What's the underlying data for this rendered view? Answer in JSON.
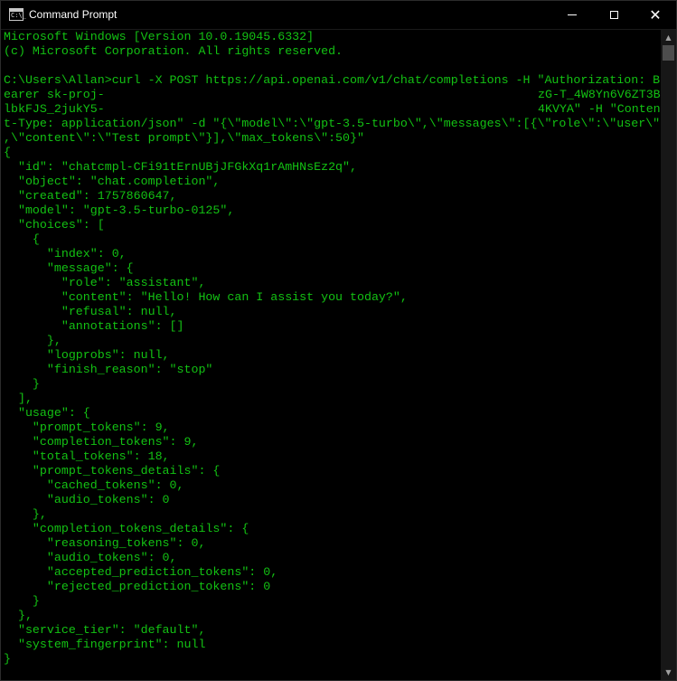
{
  "window": {
    "title": "Command Prompt",
    "icon_name": "cmd-app-icon",
    "icon_text": "C:\\_",
    "controls": {
      "minimize": "minimize-icon",
      "maximize": "maximize-icon",
      "close": "close-icon"
    }
  },
  "terminal": {
    "text_color": "#13c213",
    "background": "#000000",
    "lines": [
      "Microsoft Windows [Version 10.0.19045.6332]",
      "(c) Microsoft Corporation. All rights reserved.",
      "",
      "C:\\Users\\Allan>curl -X POST https://api.openai.com/v1/chat/completions -H \"Authorization: B",
      "earer sk-proj-",
      "lbkFJS_2jukY5-",
      "t-Type: application/json\" -d \"{\\\"model\\\":\\\"gpt-3.5-turbo\\\",\\\"messages\\\":[{\\\"role\\\":\\\"user\\\"",
      ",\\\"content\\\":\\\"Test prompt\\\"}],\\\"max_tokens\\\":50}\"",
      "{",
      "  \"id\": \"chatcmpl-CFi91tErnUBjJFGkXq1rAmHNsEz2q\",",
      "  \"object\": \"chat.completion\",",
      "  \"created\": 1757860647,",
      "  \"model\": \"gpt-3.5-turbo-0125\",",
      "  \"choices\": [",
      "    {",
      "      \"index\": 0,",
      "      \"message\": {",
      "        \"role\": \"assistant\",",
      "        \"content\": \"Hello! How can I assist you today?\",",
      "        \"refusal\": null,",
      "        \"annotations\": []",
      "      },",
      "      \"logprobs\": null,",
      "      \"finish_reason\": \"stop\"",
      "    }",
      "  ],",
      "  \"usage\": {",
      "    \"prompt_tokens\": 9,",
      "    \"completion_tokens\": 9,",
      "    \"total_tokens\": 18,",
      "    \"prompt_tokens_details\": {",
      "      \"cached_tokens\": 0,",
      "      \"audio_tokens\": 0",
      "    },",
      "    \"completion_tokens_details\": {",
      "      \"reasoning_tokens\": 0,",
      "      \"audio_tokens\": 0,",
      "      \"accepted_prediction_tokens\": 0,",
      "      \"rejected_prediction_tokens\": 0",
      "    }",
      "  },",
      "  \"service_tier\": \"default\",",
      "  \"system_fingerprint\": null",
      "}"
    ],
    "right_fragments": {
      "line5": "zG-T_4W8Yn6V6ZT3B",
      "line6": "4KVYA\" -H \"Conten"
    }
  },
  "scrollbar": {
    "up_icon": "scroll-up-arrow-icon",
    "down_icon": "scroll-down-arrow-icon",
    "position": 0
  }
}
